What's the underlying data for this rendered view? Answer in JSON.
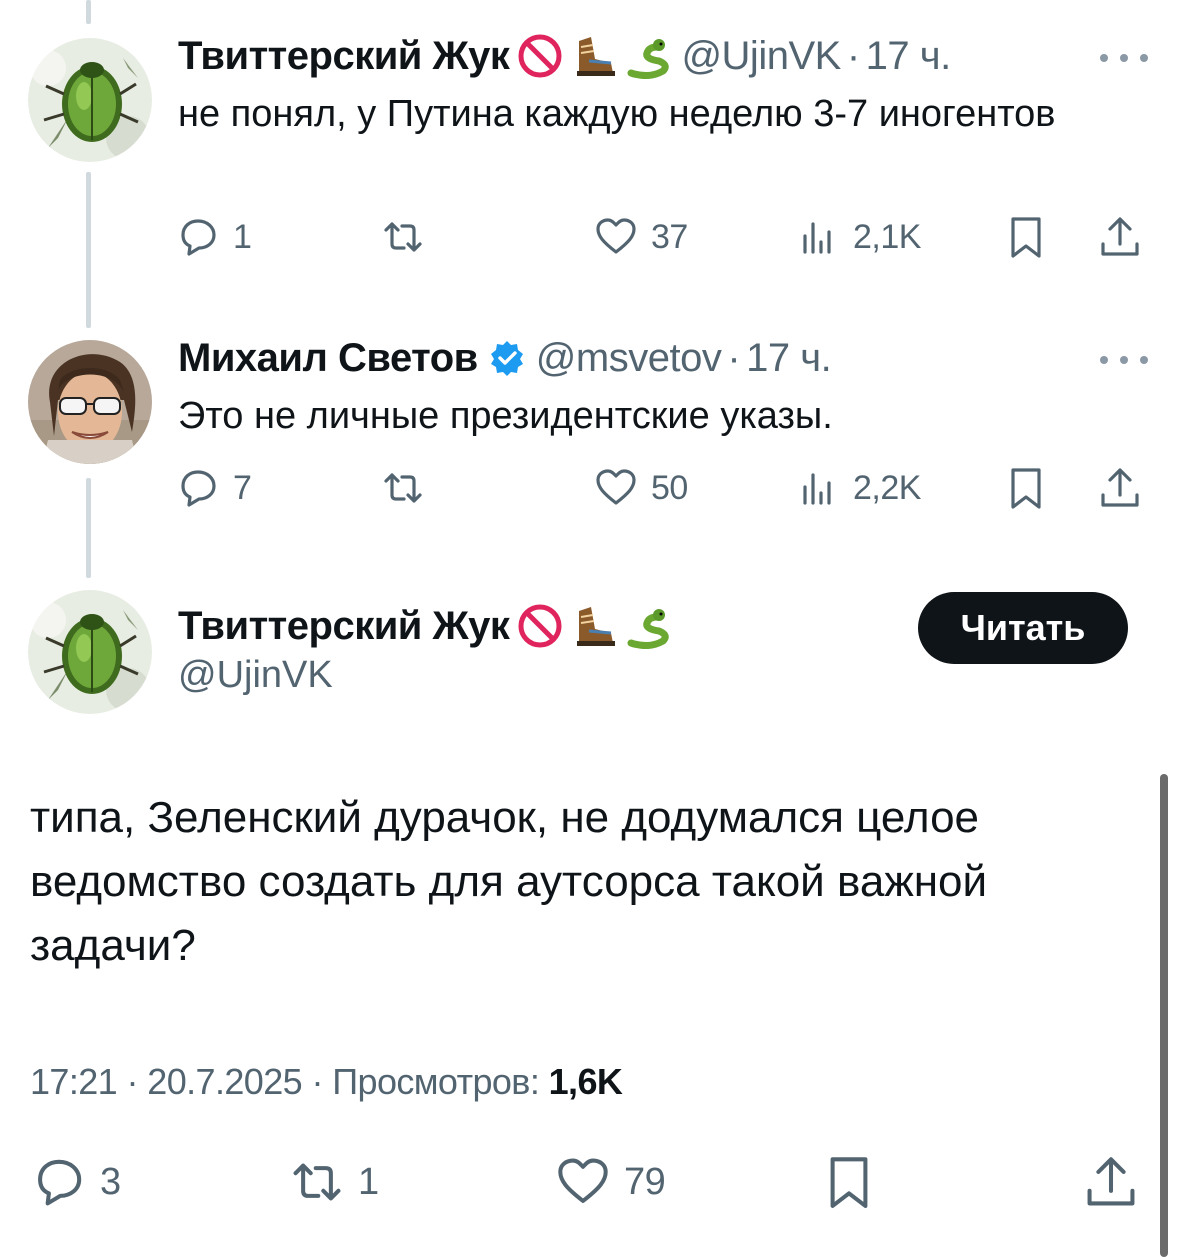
{
  "tweets": [
    {
      "name": "Твиттерский Жук",
      "emojis": [
        "no-entry-icon",
        "hiking-boot-icon",
        "snake-icon"
      ],
      "handle": "@UjinVK",
      "dot": "·",
      "time": "17 ч.",
      "text": "не понял, у Путина каждую неделю 3-7 иногентов",
      "replies": "1",
      "retweets": "",
      "likes": "37",
      "views": "2,1K"
    },
    {
      "name": "Михаил Светов",
      "verified": true,
      "handle": "@msvetov",
      "dot": "·",
      "time": "17 ч.",
      "text": "Это не личные президентские указы.",
      "replies": "7",
      "retweets": "",
      "likes": "50",
      "views": "2,2K"
    }
  ],
  "main_tweet": {
    "name": "Твиттерский Жук",
    "emojis": [
      "no-entry-icon",
      "hiking-boot-icon",
      "snake-icon"
    ],
    "handle": "@UjinVK",
    "follow_label": "Читать",
    "text": "типа, Зеленский дурачок, не додумался целое ведомство создать для аутсорса такой важной задачи?",
    "time": "17:21",
    "dot": "·",
    "date": "20.7.2025",
    "views_label": "Просмотров:",
    "views": "1,6K",
    "replies": "3",
    "retweets": "1",
    "likes": "79"
  },
  "colors": {
    "text": "#0f1419",
    "secondary": "#536471",
    "verified": "#1d9bf0",
    "button_bg": "#0f1419"
  }
}
